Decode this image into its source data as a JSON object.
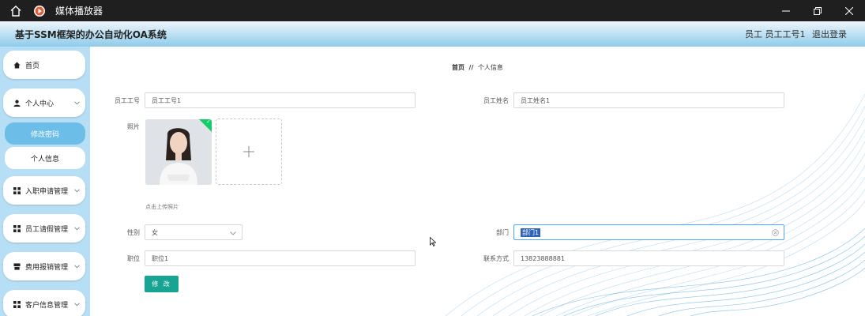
{
  "window": {
    "title": "媒体播放器"
  },
  "header": {
    "app_title": "基于SSM框架的办公自动化OA系统",
    "user": "员工 员工工号1",
    "logout": "退出登录"
  },
  "sidebar": {
    "items": [
      {
        "label": "首页",
        "icon": "home-icon"
      },
      {
        "label": "个人中心",
        "icon": "user-icon"
      },
      {
        "label": "入职申请管理",
        "icon": "grid-icon"
      },
      {
        "label": "员工请假管理",
        "icon": "grid-icon"
      },
      {
        "label": "费用报销管理",
        "icon": "cup-icon"
      },
      {
        "label": "客户信息管理",
        "icon": "grid-icon"
      }
    ],
    "sub_items": [
      {
        "label": "修改密码",
        "active": true
      },
      {
        "label": "个人信息",
        "active": false
      }
    ]
  },
  "breadcrumb": {
    "home": "首页",
    "separator": "//",
    "current": "个人信息"
  },
  "form": {
    "employee_no": {
      "label": "员工工号",
      "value": "员工工号1"
    },
    "employee_name": {
      "label": "员工姓名",
      "value": "员工姓名1"
    },
    "photo": {
      "label": "照片",
      "hint": "点击上传照片"
    },
    "gender": {
      "label": "性别",
      "value": "女"
    },
    "department": {
      "label": "部门",
      "value": "部门1"
    },
    "position": {
      "label": "职位",
      "value": "职位1"
    },
    "contact": {
      "label": "联系方式",
      "value": "13823888881"
    },
    "save_label": "修 改"
  },
  "colors": {
    "sidebar_bg": "#b6def4",
    "active_sub": "#6cbde7",
    "primary_button": "#17a493",
    "titlebar": "#1f1f1f"
  }
}
